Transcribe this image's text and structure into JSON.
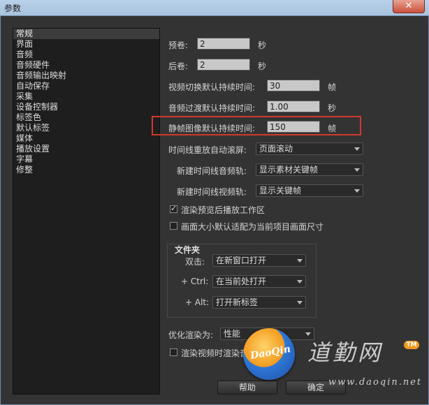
{
  "window": {
    "title": "参数",
    "close_glyph": "✕"
  },
  "sidebar": {
    "items": [
      "常规",
      "界面",
      "音频",
      "音频硬件",
      "音频输出映射",
      "自动保存",
      "采集",
      "设备控制器",
      "标签色",
      "默认标签",
      "媒体",
      "播放设置",
      "字幕",
      "修整"
    ],
    "selected_index": 0
  },
  "general": {
    "preroll": {
      "label": "预卷:",
      "value": "2",
      "unit": "秒"
    },
    "postroll": {
      "label": "后卷:",
      "value": "2",
      "unit": "秒"
    },
    "video_transition": {
      "label": "视频切换默认持续时间:",
      "value": "30",
      "unit": "帧"
    },
    "audio_transition": {
      "label": "音频过渡默认持续时间:",
      "value": "1.00",
      "unit": "秒"
    },
    "still_image": {
      "label": "静帧图像默认持续时间:",
      "value": "150",
      "unit": "帧"
    },
    "timeline_scroll": {
      "label": "时间线重放自动滚屏:",
      "value": "页面滚动"
    },
    "new_audio_track": {
      "label": "新建时间线音频轨:",
      "value": "显示素材关键帧"
    },
    "new_video_track": {
      "label": "新建时间线视频轨:",
      "value": "显示关键帧"
    },
    "render_preview": {
      "label": "渲染预览后播放工作区",
      "checked": true
    },
    "scale_frame": {
      "label": "画面大小默认适配为当前项目画面尺寸",
      "checked": false
    },
    "bins": {
      "title": "文件夹",
      "double_click": {
        "label": "双击:",
        "value": "在新窗口打开"
      },
      "ctrl": {
        "label": "+ Ctrl:",
        "value": "在当前处打开"
      },
      "alt": {
        "label": "+ Alt:",
        "value": "打开新标签"
      }
    },
    "optimize": {
      "label": "优化渲染为:",
      "value": "性能"
    },
    "render_audio": {
      "label": "渲染视频时渲染音频",
      "checked": false
    }
  },
  "buttons": {
    "help": "帮助",
    "ok": "确定"
  },
  "watermark": {
    "logo": "DaoQin",
    "text": "道勤网",
    "url": "www.daoqin.net",
    "tm": "TM"
  },
  "colors": {
    "highlight": "#d03a2e",
    "background": "#333333",
    "sidebar": "#1e1e1e"
  }
}
